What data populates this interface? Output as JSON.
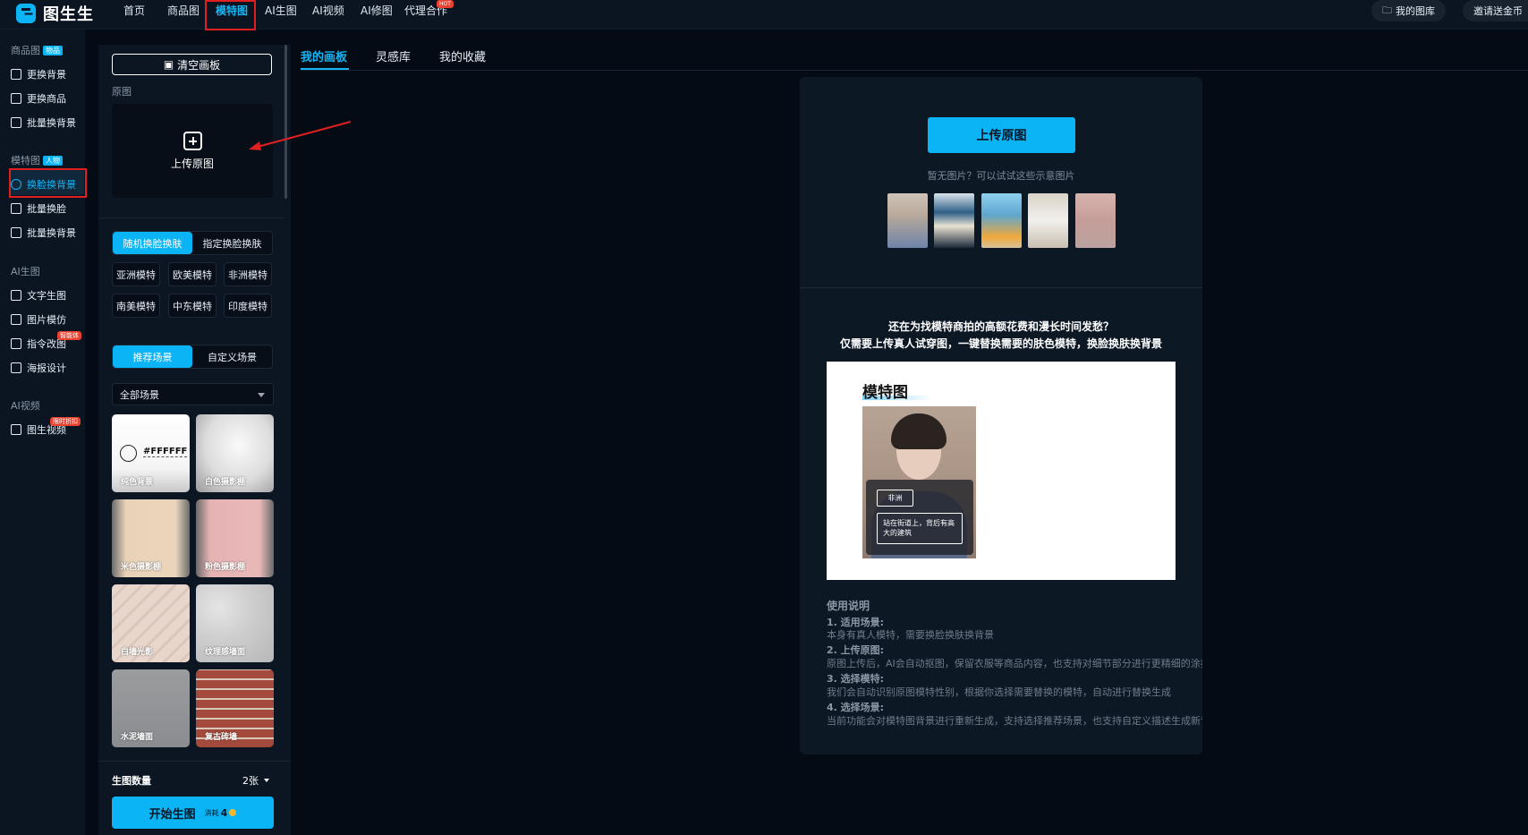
{
  "app": {
    "logo_text": "图生生"
  },
  "topnav": {
    "items": [
      {
        "label": "首页"
      },
      {
        "label": "商品图"
      },
      {
        "label": "模特图"
      },
      {
        "label": "AI生图"
      },
      {
        "label": "AI视频"
      },
      {
        "label": "AI修图"
      },
      {
        "label": "代理合作"
      }
    ],
    "active": "模特图",
    "hot_badge": "HOT",
    "my_library": "我的图库",
    "invite": "邀请送金币"
  },
  "sidebar": {
    "groups": [
      {
        "label": "商品图",
        "tag": "物品"
      },
      {
        "label": "模特图",
        "tag": "人物"
      },
      {
        "label": "AI生图"
      },
      {
        "label": "AI视频"
      }
    ],
    "items": [
      {
        "label": "更换背景"
      },
      {
        "label": "更换商品"
      },
      {
        "label": "批量换背景"
      },
      {
        "label": "换脸换背景"
      },
      {
        "label": "批量换脸"
      },
      {
        "label": "批量换背景"
      },
      {
        "label": "文字生图"
      },
      {
        "label": "图片模仿"
      },
      {
        "label": "指令改图"
      },
      {
        "label": "海报设计"
      },
      {
        "label": "图生视频"
      }
    ],
    "badges": {
      "instruct": "智能体",
      "video": "限时折扣"
    }
  },
  "panel": {
    "clear_canvas": "清空画板",
    "original_label": "原图",
    "upload_label": "上传原图",
    "face_modes": [
      "随机换脸换肤",
      "指定换脸换肤"
    ],
    "face_mode_selected": "随机换脸换肤",
    "models": [
      "亚洲模特",
      "欧美模特",
      "非洲模特",
      "南美模特",
      "中东模特",
      "印度模特"
    ],
    "scene_modes": [
      "推荐场景",
      "自定义场景"
    ],
    "scene_mode_selected": "推荐场景",
    "scene_filter": "全部场景",
    "scenes": [
      {
        "label": "纯色背景",
        "hex": "#FFFFFF"
      },
      {
        "label": "白色摄影棚"
      },
      {
        "label": "米色摄影棚"
      },
      {
        "label": "粉色摄影棚"
      },
      {
        "label": "白墙光影"
      },
      {
        "label": "纹理感墙面"
      },
      {
        "label": "水泥墙面"
      },
      {
        "label": "复古砖墙"
      }
    ],
    "count_label": "生图数量",
    "count_value": "2张",
    "start_label": "开始生图",
    "cost_label": "消耗",
    "cost_value": "4"
  },
  "tabs": [
    {
      "label": "我的画板"
    },
    {
      "label": "灵感库"
    },
    {
      "label": "我的收藏"
    }
  ],
  "canvas": {
    "upload_button": "上传原图",
    "hint": "暂无图片？可以试试这些示意图片",
    "promo_line1": "还在为找模特商拍的高额花费和漫长时间发愁？",
    "promo_line2": "仅需要上传真人试穿图，一键替换需要的肤色模特，换脸换肤换背景",
    "demo": {
      "title": "模特图",
      "tag1": "非洲",
      "tag2": "站在街道上，背后有高大的建筑"
    },
    "instructions": {
      "title": "使用说明",
      "steps": [
        {
          "h": "1. 适用场景:",
          "p": "本身有真人模特，需要换脸换肤换背景"
        },
        {
          "h": "2. 上传原图:",
          "p": "原图上传后，AI会自动抠图，保留衣服等商品内容，也支持对细节部分进行更精细的涂抹抠"
        },
        {
          "h": "3. 选择模特:",
          "p": "我们会自动识别原图模特性别，根据你选择需要替换的模特，自动进行替换生成"
        },
        {
          "h": "4. 选择场景:",
          "p": "当前功能会对模特图背景进行重新生成，支持选择推荐场景，也支持自定义描述生成新背景"
        }
      ]
    }
  },
  "colors": {
    "accent": "#0ab4f5",
    "annotation": "#e02020",
    "hot": "#e8412f"
  }
}
